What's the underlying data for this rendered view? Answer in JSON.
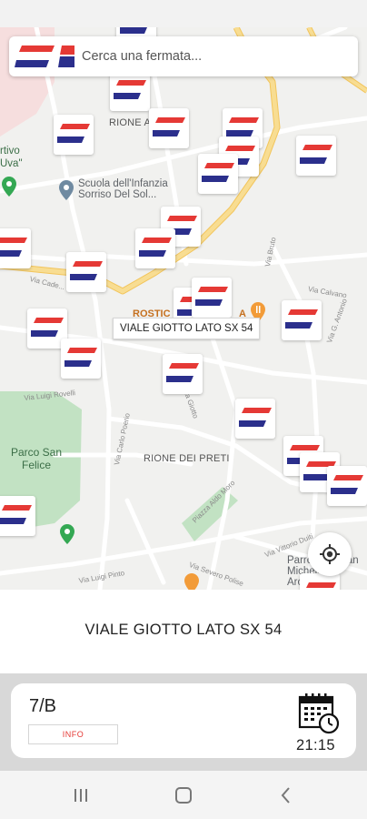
{
  "search": {
    "placeholder": "Cerca una fermata..."
  },
  "map": {
    "area_labels": [
      "RIONE ANDELAI",
      "RIONE DEI PRETI",
      "Parco San Felice"
    ],
    "places": [
      "Scuola dell'Infanzia Sorriso Del Sol...",
      "Parrocchia San Michele Arcangelo"
    ],
    "partial_labels": [
      "rtivo",
      "Uva\"",
      "ROSTIC",
      "A"
    ],
    "streets": [
      "Via Cade...",
      "Via Luigi Rovelli",
      "Via Carlo Poerio",
      "Via Giotto",
      "Via Calvano",
      "Via G. Antonio",
      "Piazza Aldo Moro",
      "Via Severo Polise",
      "Via Vittorio Duiti",
      "Via Luigi Pinto",
      "Via Bruto"
    ],
    "marker_count": 24,
    "selected_tooltip": "VIALE GIOTTO LATO SX 54",
    "colors": {
      "marker_red": "#e53935",
      "marker_blue": "#2b2f8c",
      "road_yellow": "#f6d87e",
      "park_green": "#b5dcb9"
    }
  },
  "selected_stop": {
    "name": "VIALE GIOTTO LATO SX 54"
  },
  "line": {
    "number": "7/B",
    "info_label": "INFO",
    "time": "21:15",
    "calendar_icon": "calendar-clock-icon"
  },
  "nav": {
    "recent": "recent-apps-icon",
    "home": "home-icon",
    "back": "back-icon"
  }
}
